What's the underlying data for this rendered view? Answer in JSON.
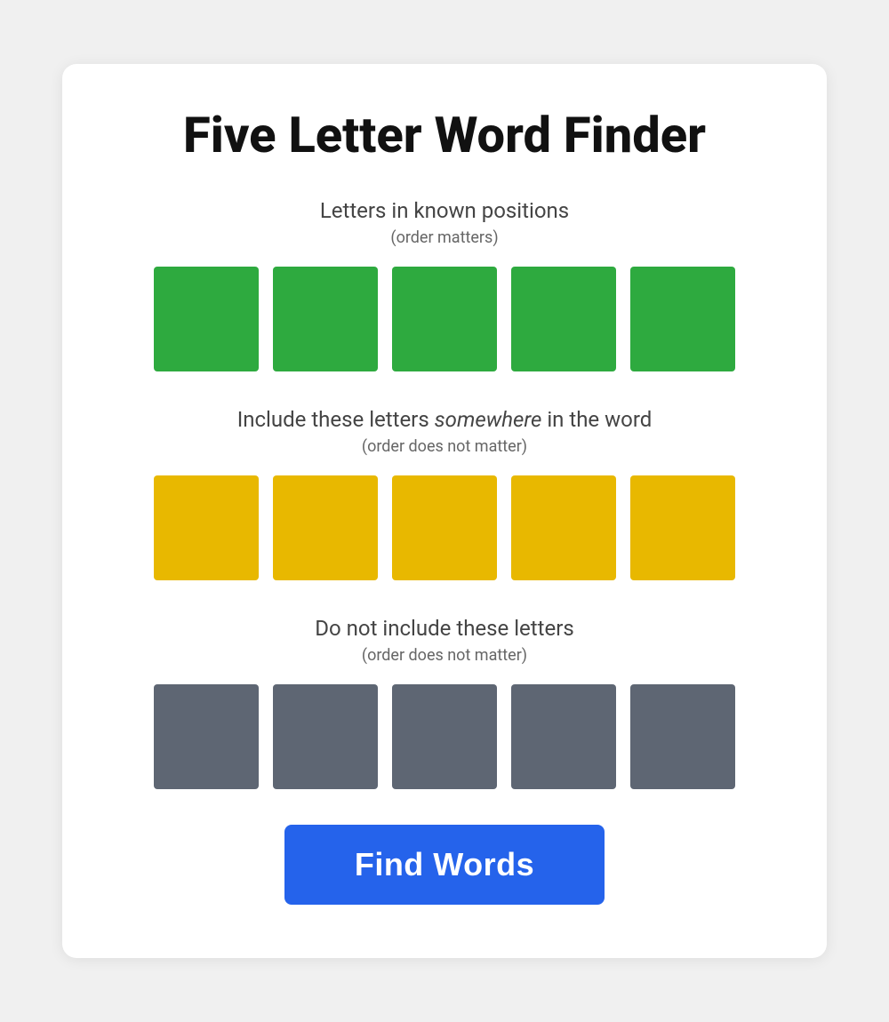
{
  "title": "Five Letter Word Finder",
  "sections": {
    "known": {
      "title": "Letters in known positions",
      "subtitle": "(order matters)",
      "color": "green",
      "tiles": [
        "",
        "",
        "",
        "",
        ""
      ]
    },
    "somewhere": {
      "title": "Include these letters",
      "title_italic": "somewhere",
      "title_suffix": " in the word",
      "subtitle": "(order does not matter)",
      "color": "yellow",
      "tiles": [
        "",
        "",
        "",
        "",
        ""
      ]
    },
    "exclude": {
      "title": "Do not include these letters",
      "subtitle": "(order does not matter)",
      "color": "gray",
      "tiles": [
        "",
        "",
        "",
        "",
        ""
      ]
    }
  },
  "button": {
    "label": "Find Words"
  }
}
